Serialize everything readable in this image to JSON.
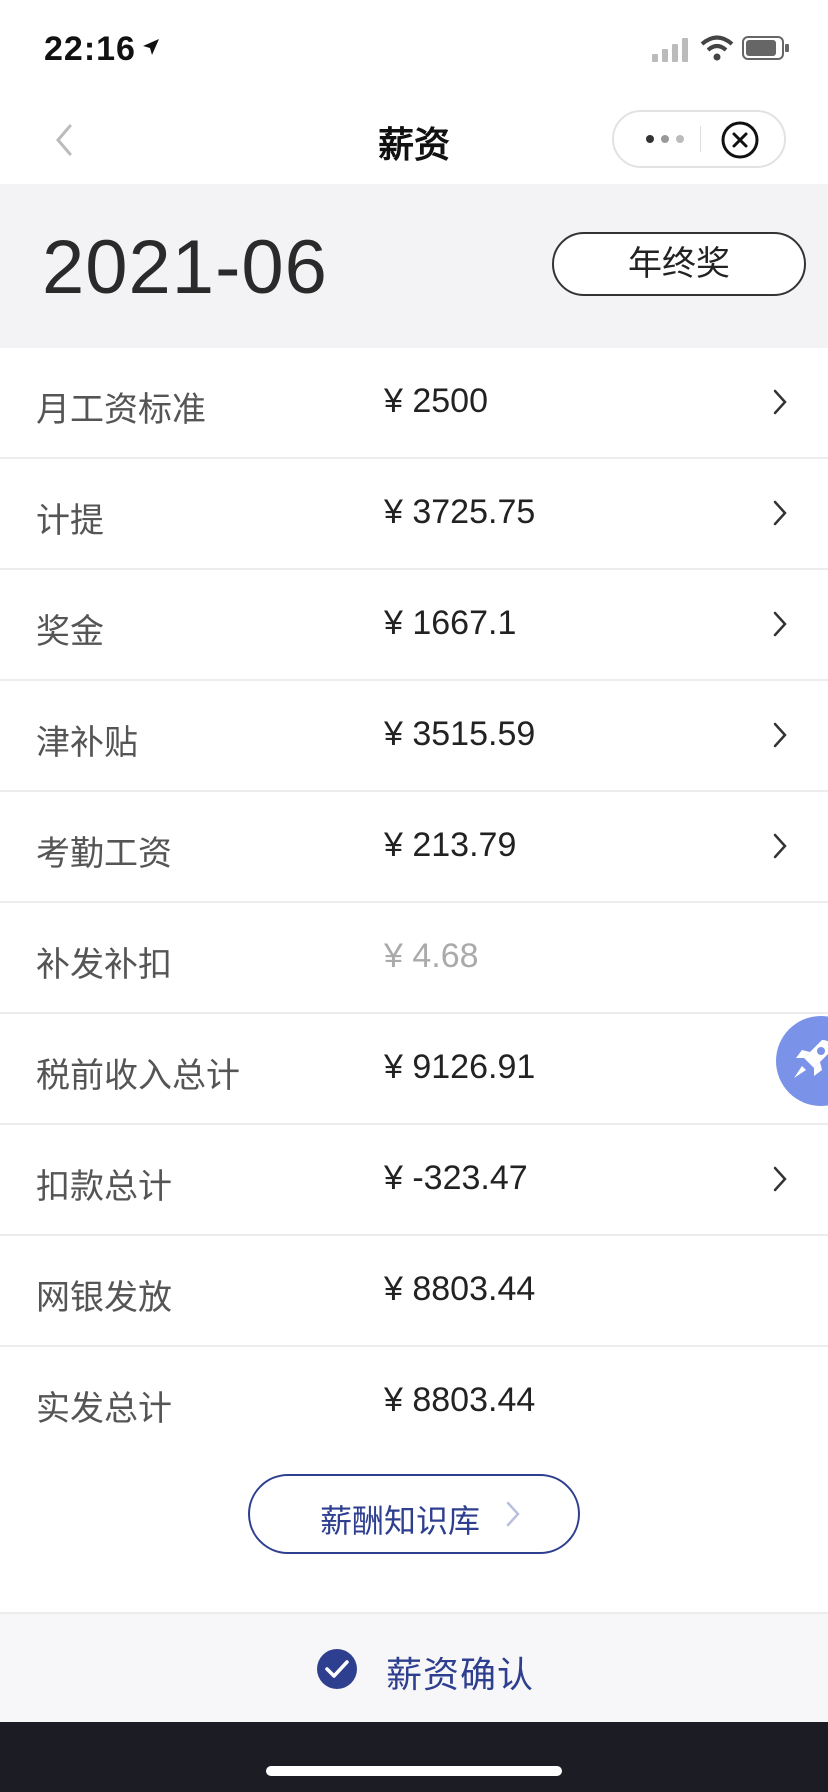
{
  "status_bar": {
    "time": "22:16"
  },
  "nav": {
    "title": "薪资"
  },
  "header": {
    "period": "2021-06",
    "bonus_label": "年终奖"
  },
  "rows": [
    {
      "label": "月工资标准",
      "value": "¥ 2500",
      "arrow": true
    },
    {
      "label": "计提",
      "value": "¥ 3725.75",
      "arrow": true
    },
    {
      "label": "奖金",
      "value": "¥ 1667.1",
      "arrow": true
    },
    {
      "label": "津补贴",
      "value": "¥ 3515.59",
      "arrow": true
    },
    {
      "label": "考勤工资",
      "value": "¥ 213.79",
      "arrow": true
    },
    {
      "label": "补发补扣",
      "value": "¥ 4.68",
      "arrow": false
    },
    {
      "label": "税前收入总计",
      "value": "¥ 9126.91",
      "arrow": false
    },
    {
      "label": "扣款总计",
      "value": "¥ -323.47",
      "arrow": true
    },
    {
      "label": "网银发放",
      "value": "¥ 8803.44",
      "arrow": false
    },
    {
      "label": "实发总计",
      "value": "¥ 8803.44",
      "arrow": false
    }
  ],
  "knowledge_base": {
    "label": "薪酬知识库"
  },
  "confirm": {
    "label": "薪资确认"
  },
  "icons": {
    "back": "chevron-left-icon",
    "more": "more-dots-icon",
    "close": "close-circle-icon",
    "row_arrow": "chevron-right-icon",
    "rocket": "rocket-icon",
    "check": "check-circle-icon"
  },
  "colors": {
    "accent": "#2f3f8f",
    "rocket_bg": "#7a92e8",
    "header_bg": "#f3f3f5",
    "home_bar": "#1c1c24"
  }
}
